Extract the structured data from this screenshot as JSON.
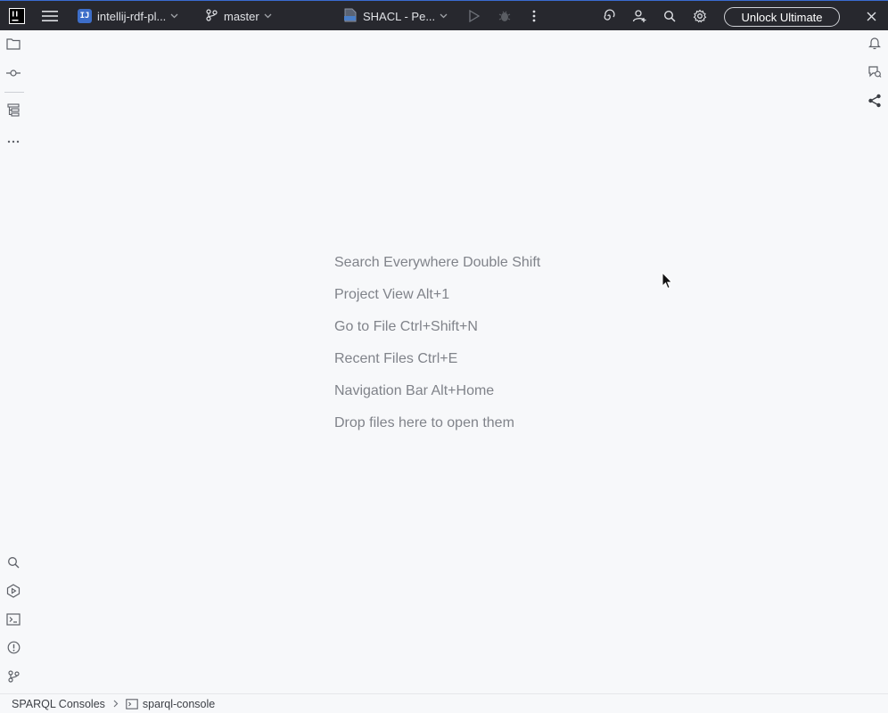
{
  "titlebar": {
    "project_name": "intellij-rdf-pl...",
    "project_badge": "IJ",
    "branch": "master",
    "run_config": "SHACL - Pe...",
    "unlock_label": "Unlock Ultimate",
    "accent_color": "#3a6bd1"
  },
  "welcome_hints": [
    "Search Everywhere Double Shift",
    "Project View Alt+1",
    "Go to File Ctrl+Shift+N",
    "Recent Files Ctrl+E",
    "Navigation Bar Alt+Home",
    "Drop files here to open them"
  ],
  "statusbar": {
    "crumb1": "SPARQL Consoles",
    "crumb2": "sparql-console"
  },
  "icons": {
    "left_top": [
      "folder-icon",
      "commit-icon",
      "structure-icon",
      "more-icon"
    ],
    "left_bottom": [
      "search-icon",
      "services-icon",
      "terminal-icon",
      "problems-icon",
      "git-icon"
    ],
    "right": [
      "notifications-icon",
      "ai-assistant-icon",
      "share-icon"
    ]
  }
}
